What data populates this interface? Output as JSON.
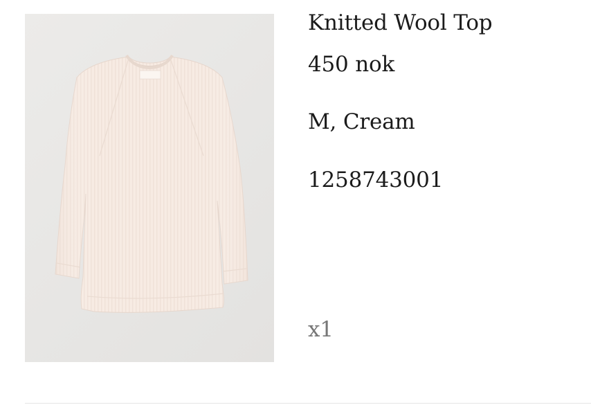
{
  "product": {
    "title": "Knitted Wool Top",
    "price": "450 nok",
    "variant": "M, Cream",
    "article_number": "1258743001",
    "quantity": "x1"
  },
  "image": {
    "description_icon": "sweater-image",
    "garment_color": "#f6e8df",
    "background_color": "#e8e7e5"
  }
}
